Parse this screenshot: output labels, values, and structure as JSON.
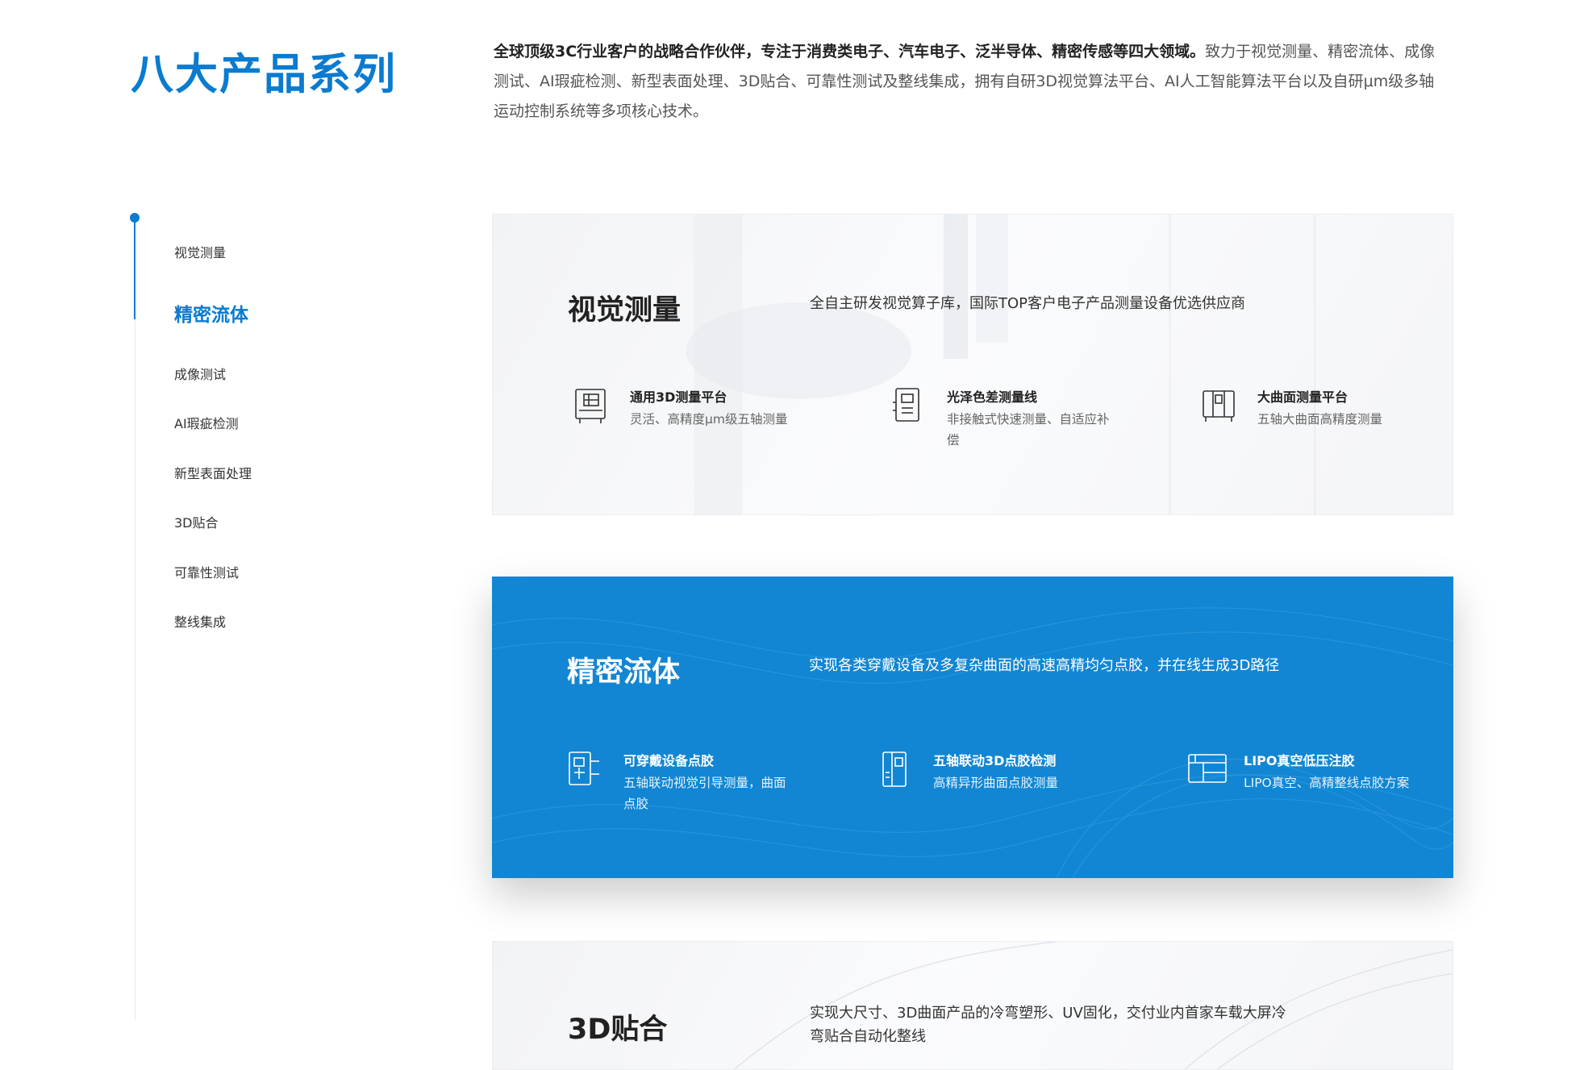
{
  "header": {
    "title": "八大产品系列",
    "intro_bold": "全球顶级3C行业客户的战略合作伙伴，专注于消费类电子、汽车电子、泛半导体、精密传感等四大领域。",
    "intro_rest": "致力于视觉测量、精密流体、成像测试、AI瑕疵检测、新型表面处理、3D贴合、可靠性测试及整线集成，拥有自研3D视觉算法平台、AI人工智能算法平台以及自研μm级多轴运动控制系统等多项核心技术。"
  },
  "nav": {
    "items": [
      {
        "label": "视觉测量",
        "active": false
      },
      {
        "label": "精密流体",
        "active": true
      },
      {
        "label": "成像测试",
        "active": false
      },
      {
        "label": "AI瑕疵检测",
        "active": false
      },
      {
        "label": "新型表面处理",
        "active": false
      },
      {
        "label": "3D贴合",
        "active": false
      },
      {
        "label": "可靠性测试",
        "active": false
      },
      {
        "label": "整线集成",
        "active": false
      }
    ]
  },
  "cards": [
    {
      "title": "视觉测量",
      "desc": "全自主研发视觉算子库，国际TOP客户电子产品测量设备优选供应商",
      "style": "light",
      "features": [
        {
          "name": "通用3D测量平台",
          "desc": "灵活、高精度μm级五轴测量",
          "icon": "measuring-platform-icon"
        },
        {
          "name": "光泽色差测量线",
          "desc": "非接触式快速测量、自适应补偿",
          "icon": "gloss-line-icon"
        },
        {
          "name": "大曲面测量平台",
          "desc": "五轴大曲面高精度测量",
          "icon": "curved-surface-icon"
        }
      ]
    },
    {
      "title": "精密流体",
      "desc": "实现各类穿戴设备及多复杂曲面的高速高精均匀点胶，并在线生成3D路径",
      "style": "blue",
      "features": [
        {
          "name": "可穿戴设备点胶",
          "desc": "五轴联动视觉引导测量，曲面点胶",
          "icon": "wearable-dispensing-icon"
        },
        {
          "name": "五轴联动3D点胶检测",
          "desc": "高精异形曲面点胶测量",
          "icon": "five-axis-icon"
        },
        {
          "name": "LIPO真空低压注胶",
          "desc": "LIPO真空、高精整线点胶方案",
          "icon": "vacuum-injection-icon"
        }
      ]
    },
    {
      "title": "3D贴合",
      "desc": "实现大尺寸、3D曲面产品的冷弯塑形、UV固化，交付业内首家车载大屏冷弯贴合自动化整线",
      "style": "light",
      "features": []
    }
  ],
  "colors": {
    "accent": "#0a7bd0",
    "card_blue": "#1286d3"
  }
}
